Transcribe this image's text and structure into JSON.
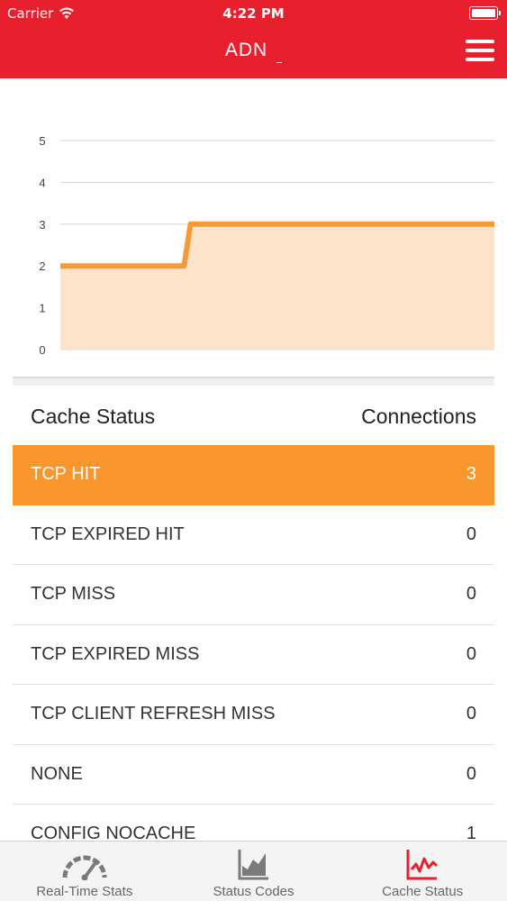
{
  "status_bar": {
    "carrier": "Carrier",
    "time": "4:22 PM"
  },
  "header": {
    "title": "ADN"
  },
  "chart_data": {
    "type": "area",
    "y_ticks": [
      "5",
      "4",
      "3",
      "2",
      "1",
      "0"
    ],
    "ylim": [
      0,
      5
    ],
    "x": [
      0,
      0.285,
      0.3,
      1
    ],
    "series": [
      {
        "values": [
          2,
          2,
          3,
          3
        ]
      }
    ],
    "line_color": "#f59a36",
    "fill_color": "#fde3c9",
    "grid": true
  },
  "table": {
    "col_status": "Cache Status",
    "col_connections": "Connections",
    "rows": [
      {
        "label": "TCP HIT",
        "value": "3",
        "selected": true
      },
      {
        "label": "TCP EXPIRED HIT",
        "value": "0"
      },
      {
        "label": "TCP MISS",
        "value": "0"
      },
      {
        "label": "TCP EXPIRED MISS",
        "value": "0"
      },
      {
        "label": "TCP CLIENT REFRESH MISS",
        "value": "0"
      },
      {
        "label": "NONE",
        "value": "0"
      },
      {
        "label": "CONFIG NOCACHE",
        "value": "1"
      }
    ]
  },
  "tabs": [
    {
      "label": "Real-Time Stats",
      "icon": "gauge-icon"
    },
    {
      "label": "Status Codes",
      "icon": "area-chart-icon"
    },
    {
      "label": "Cache Status",
      "icon": "line-chart-icon",
      "active": true
    }
  ],
  "colors": {
    "header": "#e8202e",
    "accent": "#f9972c",
    "active_icon": "#e8202e",
    "inactive_icon": "#7a7a7a"
  }
}
